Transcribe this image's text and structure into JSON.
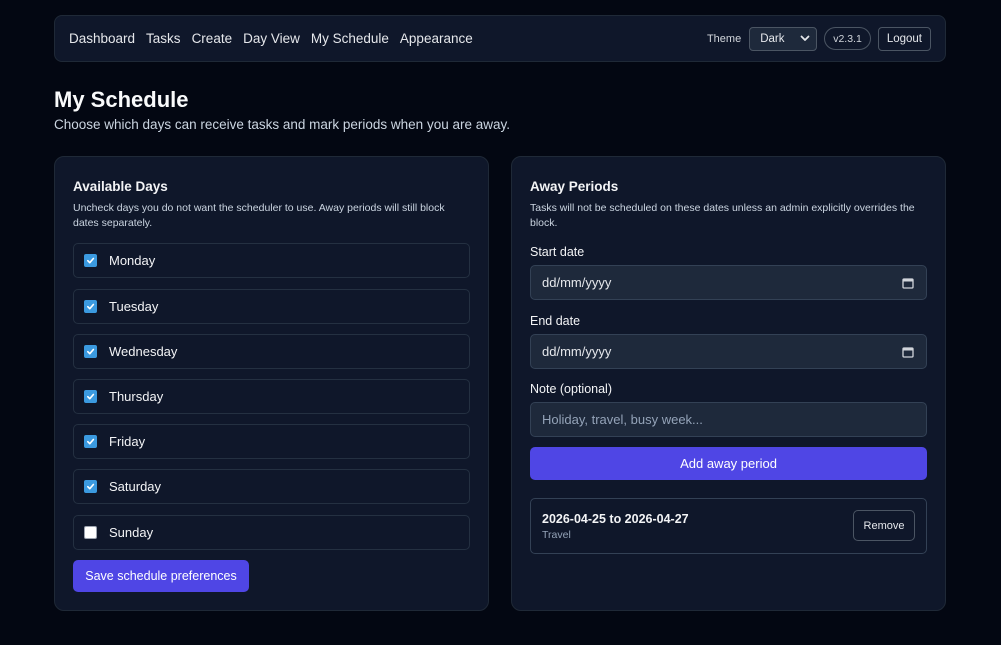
{
  "nav": {
    "links": [
      "Dashboard",
      "Tasks",
      "Create",
      "Day View",
      "My Schedule",
      "Appearance"
    ],
    "theme_label": "Theme",
    "theme_value": "Dark",
    "version": "v2.3.1",
    "logout_label": "Logout"
  },
  "page": {
    "title": "My Schedule",
    "subtitle": "Choose which days can receive tasks and mark periods when you are away."
  },
  "available_days": {
    "title": "Available Days",
    "description": "Uncheck days you do not want the scheduler to use. Away periods will still block dates separately.",
    "days": [
      {
        "label": "Monday",
        "checked": true
      },
      {
        "label": "Tuesday",
        "checked": true
      },
      {
        "label": "Wednesday",
        "checked": true
      },
      {
        "label": "Thursday",
        "checked": true
      },
      {
        "label": "Friday",
        "checked": true
      },
      {
        "label": "Saturday",
        "checked": true
      },
      {
        "label": "Sunday",
        "checked": false
      }
    ],
    "save_label": "Save schedule preferences"
  },
  "away_periods": {
    "title": "Away Periods",
    "description": "Tasks will not be scheduled on these dates unless an admin explicitly overrides the block.",
    "start_label": "Start date",
    "start_value": "dd/mm/yyyy",
    "end_label": "End date",
    "end_value": "dd/mm/yyyy",
    "note_label": "Note (optional)",
    "note_placeholder": "Holiday, travel, busy week...",
    "add_label": "Add away period",
    "items": [
      {
        "range": "2026-04-25 to 2026-04-27",
        "note": "Travel",
        "remove_label": "Remove"
      }
    ]
  },
  "colors": {
    "background": "#030712",
    "panel": "#0f172a",
    "accent": "#4f46e5",
    "checkbox": "#3b9ae0"
  }
}
